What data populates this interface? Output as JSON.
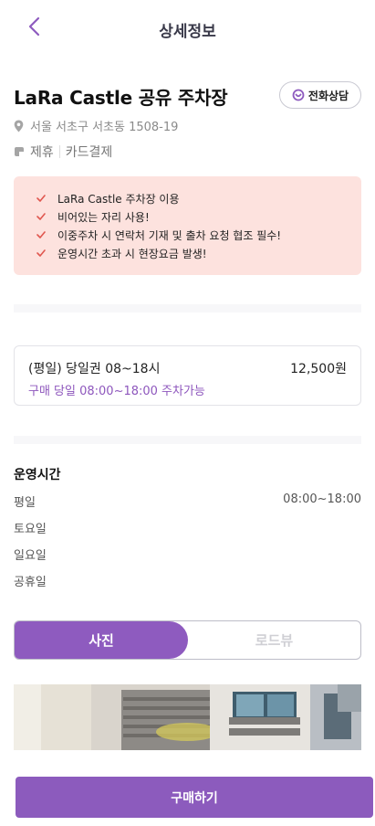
{
  "header": {
    "title": "상세정보"
  },
  "lot": {
    "name": "LaRa Castle 공유 주차장",
    "call_label": "전화상담",
    "address": "서울 서초구 서초동 1508-19",
    "tags": [
      "제휴",
      "카드결제"
    ]
  },
  "notices": [
    "LaRa Castle 주차장 이용",
    "비어있는 자리 사용!",
    "이중주차 시 연락처 기재 및 출차 요청 협조 필수!",
    "운영시간 초과 시 현장요금 발생!"
  ],
  "ticket": {
    "name": "(평일) 당일권 08~18시",
    "price": "12,500원",
    "condition": "구매 당일 08:00~18:00 주차가능"
  },
  "hours": {
    "title": "운영시간",
    "rows": [
      {
        "day": "평일",
        "time": "08:00~18:00"
      },
      {
        "day": "토요일",
        "time": ""
      },
      {
        "day": "일요일",
        "time": ""
      },
      {
        "day": "공휴일",
        "time": ""
      }
    ]
  },
  "view_tabs": {
    "photo": "사진",
    "roadview": "로드뷰",
    "selected": "photo"
  },
  "buy_label": "구매하기",
  "colors": {
    "accent": "#8c5bbd",
    "notice_bg": "#fde2de",
    "check": "#e0574f"
  }
}
